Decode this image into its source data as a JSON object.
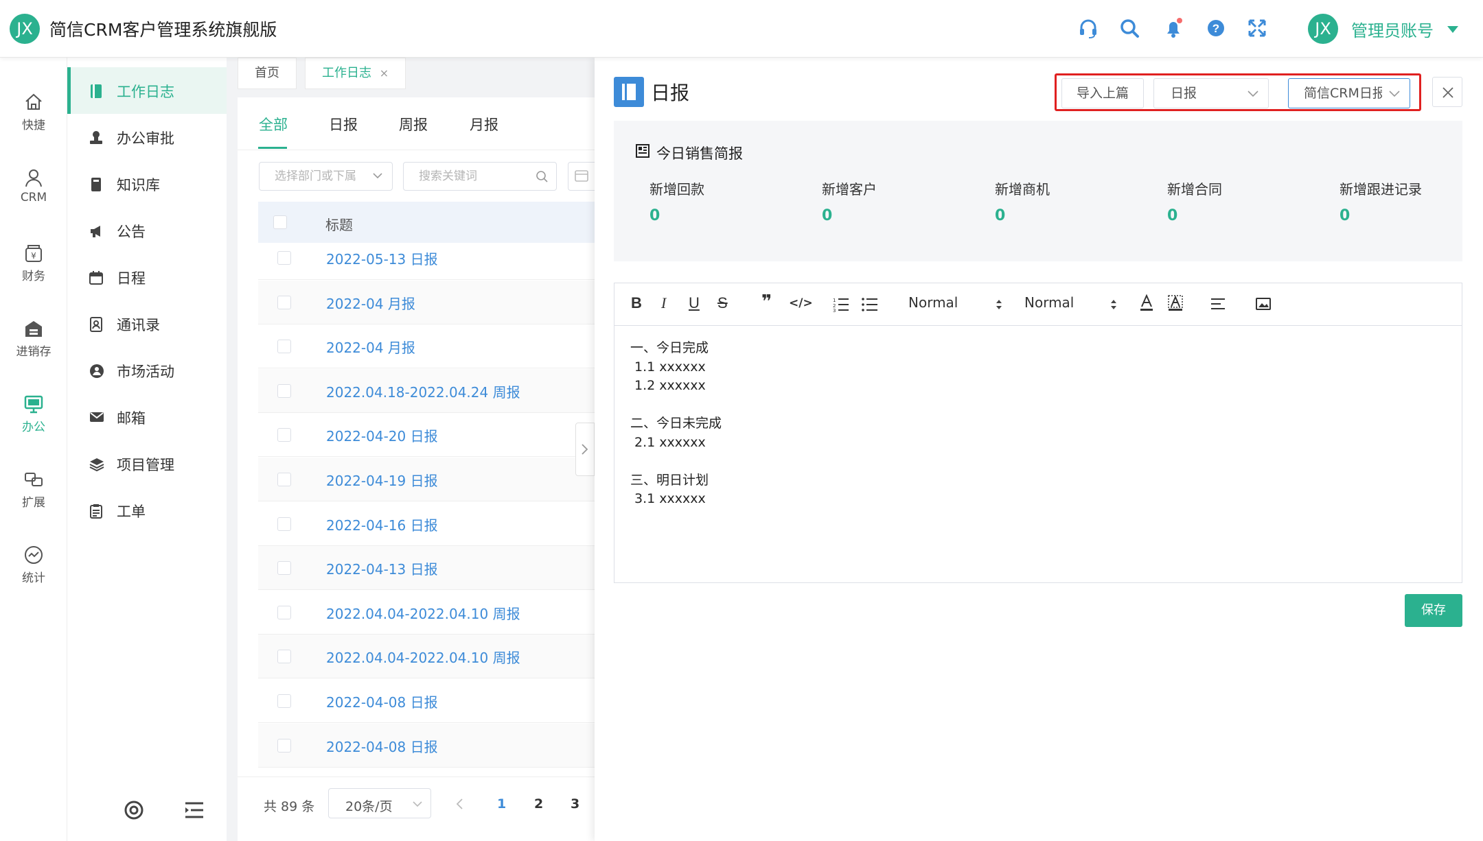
{
  "app": {
    "logo_text": "JX",
    "title": "简信CRM客户管理系统旗舰版"
  },
  "topbar": {
    "icons": [
      "headset-icon",
      "search-icon",
      "bell-icon",
      "help-icon",
      "fullscreen-icon"
    ],
    "avatar_text": "JX",
    "user_name": "管理员账号"
  },
  "rail": [
    {
      "label": "快捷",
      "icon": "home-icon"
    },
    {
      "label": "CRM",
      "icon": "user-icon"
    },
    {
      "label": "财务",
      "icon": "finance-icon"
    },
    {
      "label": "进销存",
      "icon": "warehouse-icon"
    },
    {
      "label": "办公",
      "icon": "monitor-icon",
      "active": true
    },
    {
      "label": "扩展",
      "icon": "extend-icon"
    },
    {
      "label": "统计",
      "icon": "chart-icon"
    }
  ],
  "submenu": [
    {
      "label": "工作日志",
      "icon": "notebook-icon",
      "active": true
    },
    {
      "label": "办公审批",
      "icon": "stamp-icon"
    },
    {
      "label": "知识库",
      "icon": "book-icon"
    },
    {
      "label": "公告",
      "icon": "megaphone-icon"
    },
    {
      "label": "日程",
      "icon": "calendar-icon"
    },
    {
      "label": "通讯录",
      "icon": "contacts-icon"
    },
    {
      "label": "市场活动",
      "icon": "market-icon"
    },
    {
      "label": "邮箱",
      "icon": "mail-icon"
    },
    {
      "label": "项目管理",
      "icon": "layers-icon"
    },
    {
      "label": "工单",
      "icon": "clipboard-icon"
    }
  ],
  "tabs": {
    "home": "首页",
    "current": "工作日志",
    "close": "×"
  },
  "filter_tabs": [
    "全部",
    "日报",
    "周报",
    "月报"
  ],
  "filters": {
    "dept_placeholder": "选择部门或下属",
    "keyword_placeholder": "搜索关键词"
  },
  "table": {
    "header": "标题",
    "rows": [
      "2022-05-13 日报",
      "2022-04 月报",
      "2022-04 月报",
      "2022.04.18-2022.04.24 周报",
      "2022-04-20 日报",
      "2022-04-19 日报",
      "2022-04-16 日报",
      "2022-04-13 日报",
      "2022.04.04-2022.04.10 周报",
      "2022.04.04-2022.04.10 周报",
      "2022-04-08 日报",
      "2022-04-08 日报"
    ]
  },
  "pager": {
    "total": "共 89 条",
    "page_size": "20条/页",
    "pages": [
      "1",
      "2",
      "3"
    ],
    "current_page": "1"
  },
  "detail": {
    "title": "日报",
    "import_btn": "导入上篇",
    "type_select": "日报",
    "template_select": "简信CRM日报",
    "summary_title": "今日销售简报",
    "stats": [
      {
        "label": "新增回款",
        "value": "0"
      },
      {
        "label": "新增客户",
        "value": "0"
      },
      {
        "label": "新增商机",
        "value": "0"
      },
      {
        "label": "新增合同",
        "value": "0"
      },
      {
        "label": "新增跟进记录",
        "value": "0"
      }
    ],
    "toolbar": {
      "font_select": "Normal",
      "size_select": "Normal"
    },
    "body_lines": [
      "一、今日完成",
      " 1.1 xxxxxx",
      " 1.2 xxxxxx",
      "",
      "二、今日未完成",
      " 2.1 xxxxxx",
      "",
      "三、明日计划",
      " 3.1 xxxxxx"
    ],
    "save": "保存"
  },
  "colors": {
    "accent": "#2bb18f",
    "link": "#3d8bd8",
    "highlight": "#e02020"
  }
}
